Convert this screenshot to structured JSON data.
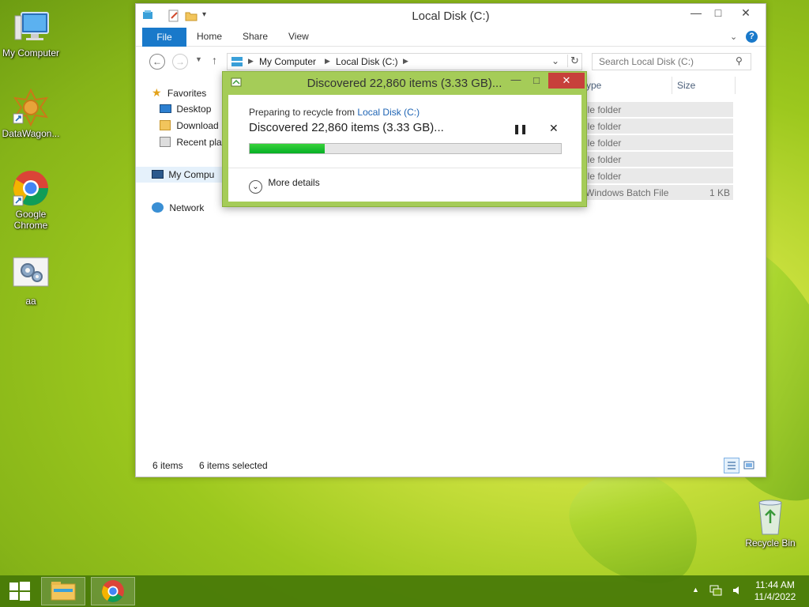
{
  "desktop": {
    "icons": [
      {
        "label": "My Computer",
        "icon": "computer-icon"
      },
      {
        "label": "DataWagon...",
        "icon": "datawagon-icon"
      },
      {
        "label": "Google Chrome",
        "icon": "chrome-icon"
      },
      {
        "label": "aa",
        "icon": "settings-file-icon"
      },
      {
        "label": "Recycle Bin",
        "icon": "recycle-bin-icon"
      }
    ]
  },
  "explorer": {
    "title": "Local Disk (C:)",
    "ribbon_tabs": [
      "File",
      "Home",
      "Share",
      "View"
    ],
    "breadcrumb": [
      "My Computer",
      "Local Disk (C:)"
    ],
    "search_placeholder": "Search Local Disk (C:)",
    "nav": {
      "favorites": "Favorites",
      "desktop": "Desktop",
      "downloads": "Download",
      "recent": "Recent pla",
      "my_computer": "My Compu",
      "network": "Network"
    },
    "columns": {
      "type": "ype",
      "size": "Size"
    },
    "rows": [
      {
        "type": "ile folder",
        "size": ""
      },
      {
        "type": "ile folder",
        "size": ""
      },
      {
        "type": "ile folder",
        "size": ""
      },
      {
        "type": "ile folder",
        "size": ""
      },
      {
        "type": "ile folder",
        "size": ""
      },
      {
        "type": "Windows Batch File",
        "size": "1 KB"
      }
    ],
    "status": {
      "items": "6 items",
      "selected": "6 items selected"
    }
  },
  "dialog": {
    "title": "Discovered 22,860 items (3.33 GB)...",
    "preparing_prefix": "Preparing to recycle from",
    "preparing_link": "Local Disk (C:)",
    "headline": "Discovered 22,860 items (3.33 GB)...",
    "progress_percent": 24,
    "more_details": "More details"
  },
  "taskbar": {
    "time": "11:44 AM",
    "date": "11/4/2022"
  },
  "colors": {
    "accent": "#1979ca",
    "progress": "#06b025",
    "dialog_frame": "#a5cc58",
    "close": "#c7403b"
  }
}
